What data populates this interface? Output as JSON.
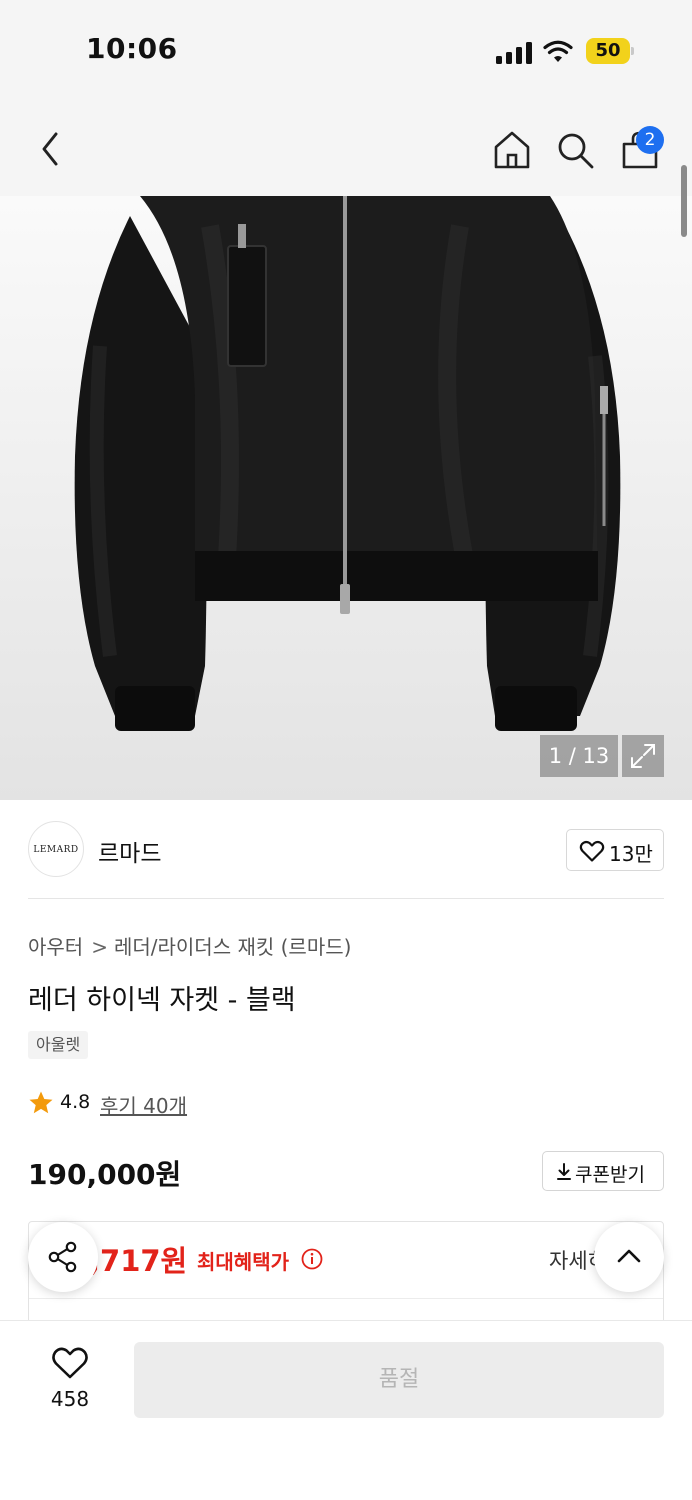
{
  "status_bar": {
    "time": "10:06",
    "battery": "50"
  },
  "header": {
    "cart_count": "2"
  },
  "gallery": {
    "counter": "1 / 13"
  },
  "brand": {
    "logo_text": "LEMARD",
    "name": "르마드",
    "likes": "13만"
  },
  "breadcrumb": {
    "category": "아우터",
    "separator": ">",
    "subcategory": "레더/라이더스 재킷 (르마드)"
  },
  "product": {
    "title": "레더 하이넥 자켓 - 블랙",
    "tag": "아울렛",
    "rating": "4.8",
    "reviews": "후기 40개",
    "price": "190,000원",
    "coupon_label": "쿠폰받기"
  },
  "benefit": {
    "price": ",717원",
    "label": "최대혜택가",
    "detail": "자세히"
  },
  "bottom": {
    "wish_count": "458",
    "buy_button": "품절"
  },
  "colors": {
    "accent_red": "#e2231a",
    "badge_blue": "#1e6ff0",
    "battery_yellow": "#f2d21b"
  },
  "icons": [
    "back-icon",
    "home-icon",
    "search-icon",
    "bag-icon",
    "expand-icon",
    "heart-icon",
    "star-icon",
    "download-icon",
    "info-icon",
    "share-icon",
    "chevron-up-icon"
  ]
}
